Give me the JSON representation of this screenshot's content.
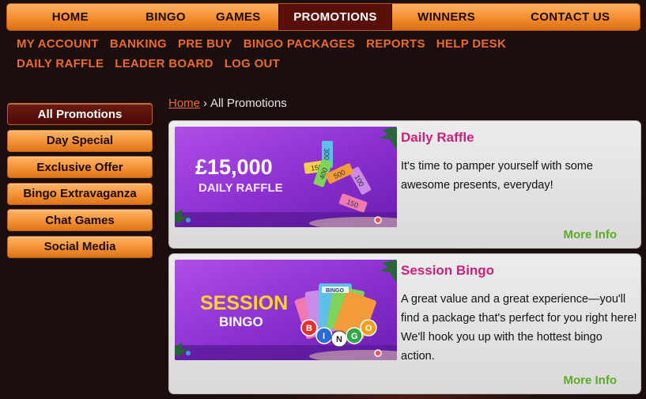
{
  "topnav": {
    "items": [
      {
        "label": "HOME",
        "active": false
      },
      {
        "label": "BINGO",
        "active": false
      },
      {
        "label": "GAMES",
        "active": false
      },
      {
        "label": "PROMOTIONS",
        "active": true
      },
      {
        "label": "WINNERS",
        "active": false
      },
      {
        "label": "CONTACT US",
        "active": false
      }
    ]
  },
  "subnav": {
    "items": [
      "MY ACCOUNT",
      "BANKING",
      "PRE BUY",
      "BINGO PACKAGES",
      "REPORTS",
      "HELP DESK",
      "DAILY RAFFLE",
      "LEADER BOARD",
      "LOG OUT"
    ]
  },
  "sidebar": {
    "items": [
      {
        "label": "All Promotions",
        "active": true
      },
      {
        "label": "Day Special",
        "active": false
      },
      {
        "label": "Exclusive Offer",
        "active": false
      },
      {
        "label": "Bingo Extravaganza",
        "active": false
      },
      {
        "label": "Chat Games",
        "active": false
      },
      {
        "label": "Social Media",
        "active": false
      }
    ]
  },
  "breadcrumb": {
    "home": "Home",
    "separator": "›",
    "current": "All Promotions"
  },
  "cards": [
    {
      "title": "Daily Raffle",
      "description": "It's time to pamper yourself with some awesome presents, everyday!",
      "more": "More Info",
      "image": {
        "line1": "£15,000",
        "line2": "DAILY RAFFLE",
        "ticket_numbers": [
          "150",
          "300",
          "100",
          "400",
          "150",
          "500"
        ]
      }
    },
    {
      "title": "Session Bingo",
      "description": "A great value and a great experience—you'll find a package that's perfect for you right here! We'll hook you up with the hottest bingo action.",
      "more": "More Info",
      "image": {
        "line1": "SESSION",
        "line2": "BINGO",
        "card_word": "BINGO",
        "balls": [
          "B",
          "I",
          "N",
          "G",
          "O"
        ]
      }
    }
  ],
  "colors": {
    "background": "#1a0f0e",
    "nav_orange": "#f38d2e",
    "nav_active": "#5a0f08",
    "subnav_link": "#ee6a2a",
    "card_title": "#c9217c",
    "more_info": "#5aac25",
    "promo_purple": "#8a2fd0"
  }
}
